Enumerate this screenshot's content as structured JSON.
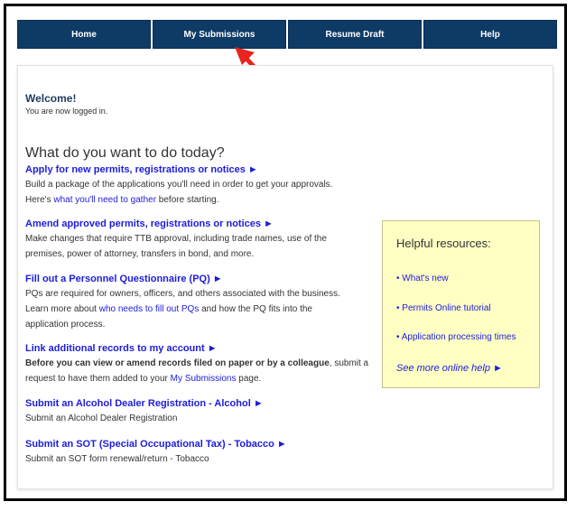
{
  "nav": {
    "items": [
      "Home",
      "My Submissions",
      "Resume Draft",
      "Help"
    ]
  },
  "welcome": {
    "title": "Welcome!",
    "subtitle": "You are now logged in."
  },
  "main": {
    "heading": "What do you want to do today?",
    "sections": [
      {
        "link": "Apply for new permits, registrations or notices ►",
        "desc1": "Build a package of the applications you'll need in order to get your approvals.",
        "desc2_pre": "Here's ",
        "desc2_link": "what you'll need to gather",
        "desc2_post": " before starting."
      },
      {
        "link": "Amend approved permits, registrations or notices ►",
        "desc1": "Make changes that require TTB approval, including trade names, use of the",
        "desc2": "premises, power of attorney, transfers in bond, and more."
      },
      {
        "link": "Fill out a Personnel Questionnaire (PQ) ►",
        "desc1": "PQs are required for owners, officers, and others associated with the business.",
        "desc2_pre": "Learn more about ",
        "desc2_link": "who needs to fill out PQs",
        "desc2_post": " and how the PQ fits into the",
        "desc3": "application process."
      },
      {
        "link": "Link additional records to my account ►",
        "desc1_bold": "Before you can view or amend records filed on paper or by a colleague",
        "desc1_post": ", submit a",
        "desc2_pre": "request to have them added to your ",
        "desc2_link": "My Submissions",
        "desc2_post": " page."
      },
      {
        "link": "Submit an Alcohol Dealer Registration - Alcohol ►",
        "desc1": "Submit an Alcohol Dealer Registration"
      },
      {
        "link": "Submit an SOT (Special Occupational Tax) - Tobacco ►",
        "desc1": "Submit an SOT form renewal/return - Tobacco"
      }
    ]
  },
  "resources": {
    "title": "Helpful resources:",
    "items": [
      "• What's new",
      "• Permits Online tutorial",
      "• Application processing times"
    ],
    "more": "See more online help ►"
  },
  "colors": {
    "nav_bg": "#0e3a66",
    "link": "#1d1ddb",
    "resources_bg": "#ffffc4",
    "arrow": "#e8251c"
  }
}
